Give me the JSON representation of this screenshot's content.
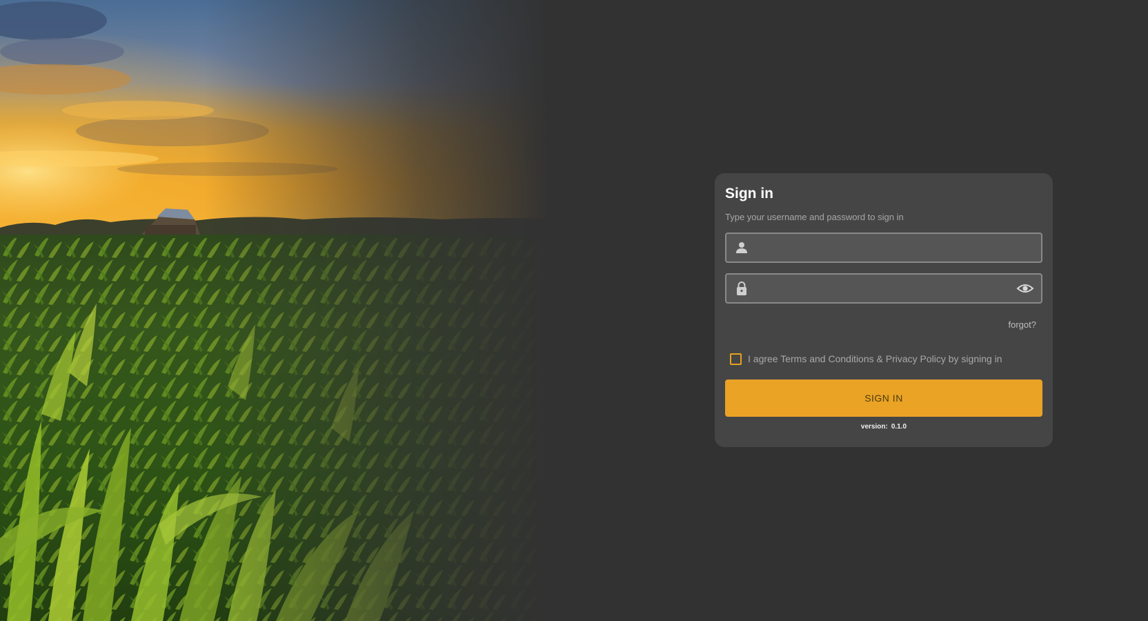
{
  "hero": {
    "alt": "Cornfield at sunset with a barn on the horizon"
  },
  "login": {
    "title": "Sign in",
    "subtitle": "Type your username and password to sign in",
    "username": {
      "value": "",
      "placeholder": "",
      "icon": "user-icon"
    },
    "password": {
      "value": "",
      "placeholder": "",
      "icon": "lock-icon",
      "toggle_icon": "eye-icon"
    },
    "forgot_label": "forgot?",
    "agree_label": "I agree Terms and Conditions & Privacy Policy by signing in",
    "agree_checked": false,
    "submit_label": "SIGN IN",
    "version_label": "version:",
    "version_value": "0.1.0"
  },
  "colors": {
    "background": "#323232",
    "card": "#454545",
    "accent": "#eaa325"
  }
}
